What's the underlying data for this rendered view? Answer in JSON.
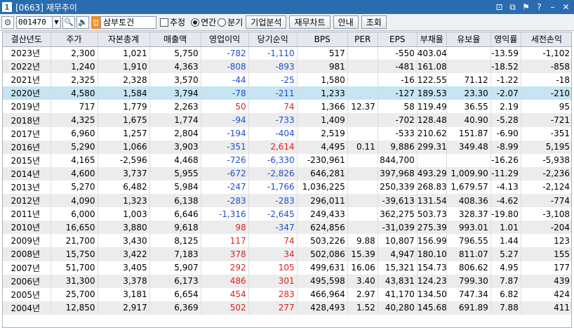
{
  "window": {
    "number": "1",
    "title": "[0663] 재무추이",
    "controls": [
      "⊡",
      "⧉",
      "⚑",
      "?",
      "–",
      "✕"
    ]
  },
  "toolbar": {
    "code": "001470",
    "badge": "업",
    "company": "삼부토건",
    "estimate_label": "추정",
    "annual_label": "연간",
    "quarter_label": "분기",
    "selected_period": "연간",
    "btn_company": "기업분석",
    "btn_fin_chart": "재무차트",
    "btn_guide": "안내",
    "btn_query": "조회"
  },
  "colors": {
    "negative": "#1f4fcf",
    "positive": "#e02020",
    "selected_row": "#c6e4f2"
  },
  "table": {
    "headers": [
      "결산년도",
      "주가",
      "자본총계",
      "매출액",
      "영업이익",
      "당기순익",
      "BPS",
      "PER",
      "EPS",
      "부채율",
      "유보율",
      "영익률",
      "세전손익"
    ],
    "rows": [
      [
        "2023년",
        "2,300",
        "1,021",
        "5,750",
        "-782",
        "-1,110",
        "517",
        "",
        "-550",
        "403.04",
        "",
        "-13.59",
        "-1,102"
      ],
      [
        "2022년",
        "1,240",
        "1,910",
        "4,363",
        "-808",
        "-893",
        "981",
        "",
        "-481",
        "161.08",
        "",
        "-18.52",
        "-858"
      ],
      [
        "2021년",
        "2,325",
        "2,328",
        "3,570",
        "-44",
        "-25",
        "1,580",
        "",
        "-16",
        "122.55",
        "71.12",
        "-1.22",
        "-18"
      ],
      [
        "2020년",
        "4,580",
        "1,584",
        "3,794",
        "-78",
        "-211",
        "1,233",
        "",
        "-127",
        "189.53",
        "23.30",
        "-2.07",
        "-210"
      ],
      [
        "2019년",
        "717",
        "1,779",
        "2,263",
        "50",
        "74",
        "1,366",
        "12.37",
        "58",
        "119.49",
        "36.55",
        "2.19",
        "95"
      ],
      [
        "2018년",
        "4,325",
        "1,675",
        "1,774",
        "-94",
        "-733",
        "1,409",
        "",
        "-702",
        "128.48",
        "40.90",
        "-5.28",
        "-721"
      ],
      [
        "2017년",
        "6,960",
        "1,257",
        "2,804",
        "-194",
        "-404",
        "2,519",
        "",
        "-533",
        "210.62",
        "151.87",
        "-6.90",
        "-351"
      ],
      [
        "2016년",
        "5,290",
        "1,066",
        "3,903",
        "-351",
        "2,614",
        "4,495",
        "0.11",
        "9,886",
        "299.31",
        "349.48",
        "-8.99",
        "5,195"
      ],
      [
        "2015년",
        "4,165",
        "-2,596",
        "4,468",
        "-726",
        "-6,330",
        "-230,961",
        "",
        "844,700",
        "",
        "",
        "-16.26",
        "-5,938"
      ],
      [
        "2014년",
        "4,600",
        "3,737",
        "5,955",
        "-672",
        "-2,826",
        "646,281",
        "",
        "397,968",
        "493.29",
        "1,009.90",
        "-11.29",
        "-2,236"
      ],
      [
        "2013년",
        "5,270",
        "6,482",
        "5,984",
        "-247",
        "-1,766",
        "1,036,225",
        "",
        "250,339",
        "268.83",
        "1,679.57",
        "-4.13",
        "-2,124"
      ],
      [
        "2012년",
        "4,090",
        "1,323",
        "6,138",
        "-283",
        "-283",
        "296,011",
        "",
        "-39,613",
        "131.54",
        "408.36",
        "-4.62",
        "-774"
      ],
      [
        "2011년",
        "6,000",
        "1,003",
        "6,646",
        "-1,316",
        "-2,645",
        "249,433",
        "",
        "362,275",
        "503.73",
        "328.37",
        "-19.80",
        "-3,108"
      ],
      [
        "2010년",
        "16,650",
        "3,880",
        "9,618",
        "98",
        "-347",
        "624,856",
        "",
        "-31,039",
        "275.39",
        "993.01",
        "1.01",
        "-204"
      ],
      [
        "2009년",
        "21,700",
        "3,430",
        "8,125",
        "117",
        "74",
        "503,226",
        "9.88",
        "10,807",
        "156.99",
        "796.55",
        "1.44",
        "123"
      ],
      [
        "2008년",
        "15,750",
        "3,422",
        "7,183",
        "378",
        "34",
        "502,086",
        "15.39",
        "4,947",
        "180.10",
        "811.07",
        "5.27",
        "155"
      ],
      [
        "2007년",
        "51,700",
        "3,405",
        "5,907",
        "292",
        "105",
        "499,631",
        "16.06",
        "15,321",
        "154.73",
        "806.62",
        "4.95",
        "177"
      ],
      [
        "2006년",
        "31,300",
        "3,378",
        "6,173",
        "486",
        "301",
        "495,598",
        "3.40",
        "43,831",
        "124.23",
        "799.30",
        "7.87",
        "439"
      ],
      [
        "2005년",
        "25,700",
        "3,181",
        "6,654",
        "454",
        "283",
        "466,964",
        "2.97",
        "41,170",
        "134.50",
        "747.34",
        "6.82",
        "424"
      ],
      [
        "2004년",
        "12,850",
        "2,917",
        "6,369",
        "502",
        "277",
        "428,493",
        "1.52",
        "40,280",
        "145.68",
        "691.89",
        "7.88",
        "411"
      ]
    ],
    "selected_row": "2020년"
  }
}
